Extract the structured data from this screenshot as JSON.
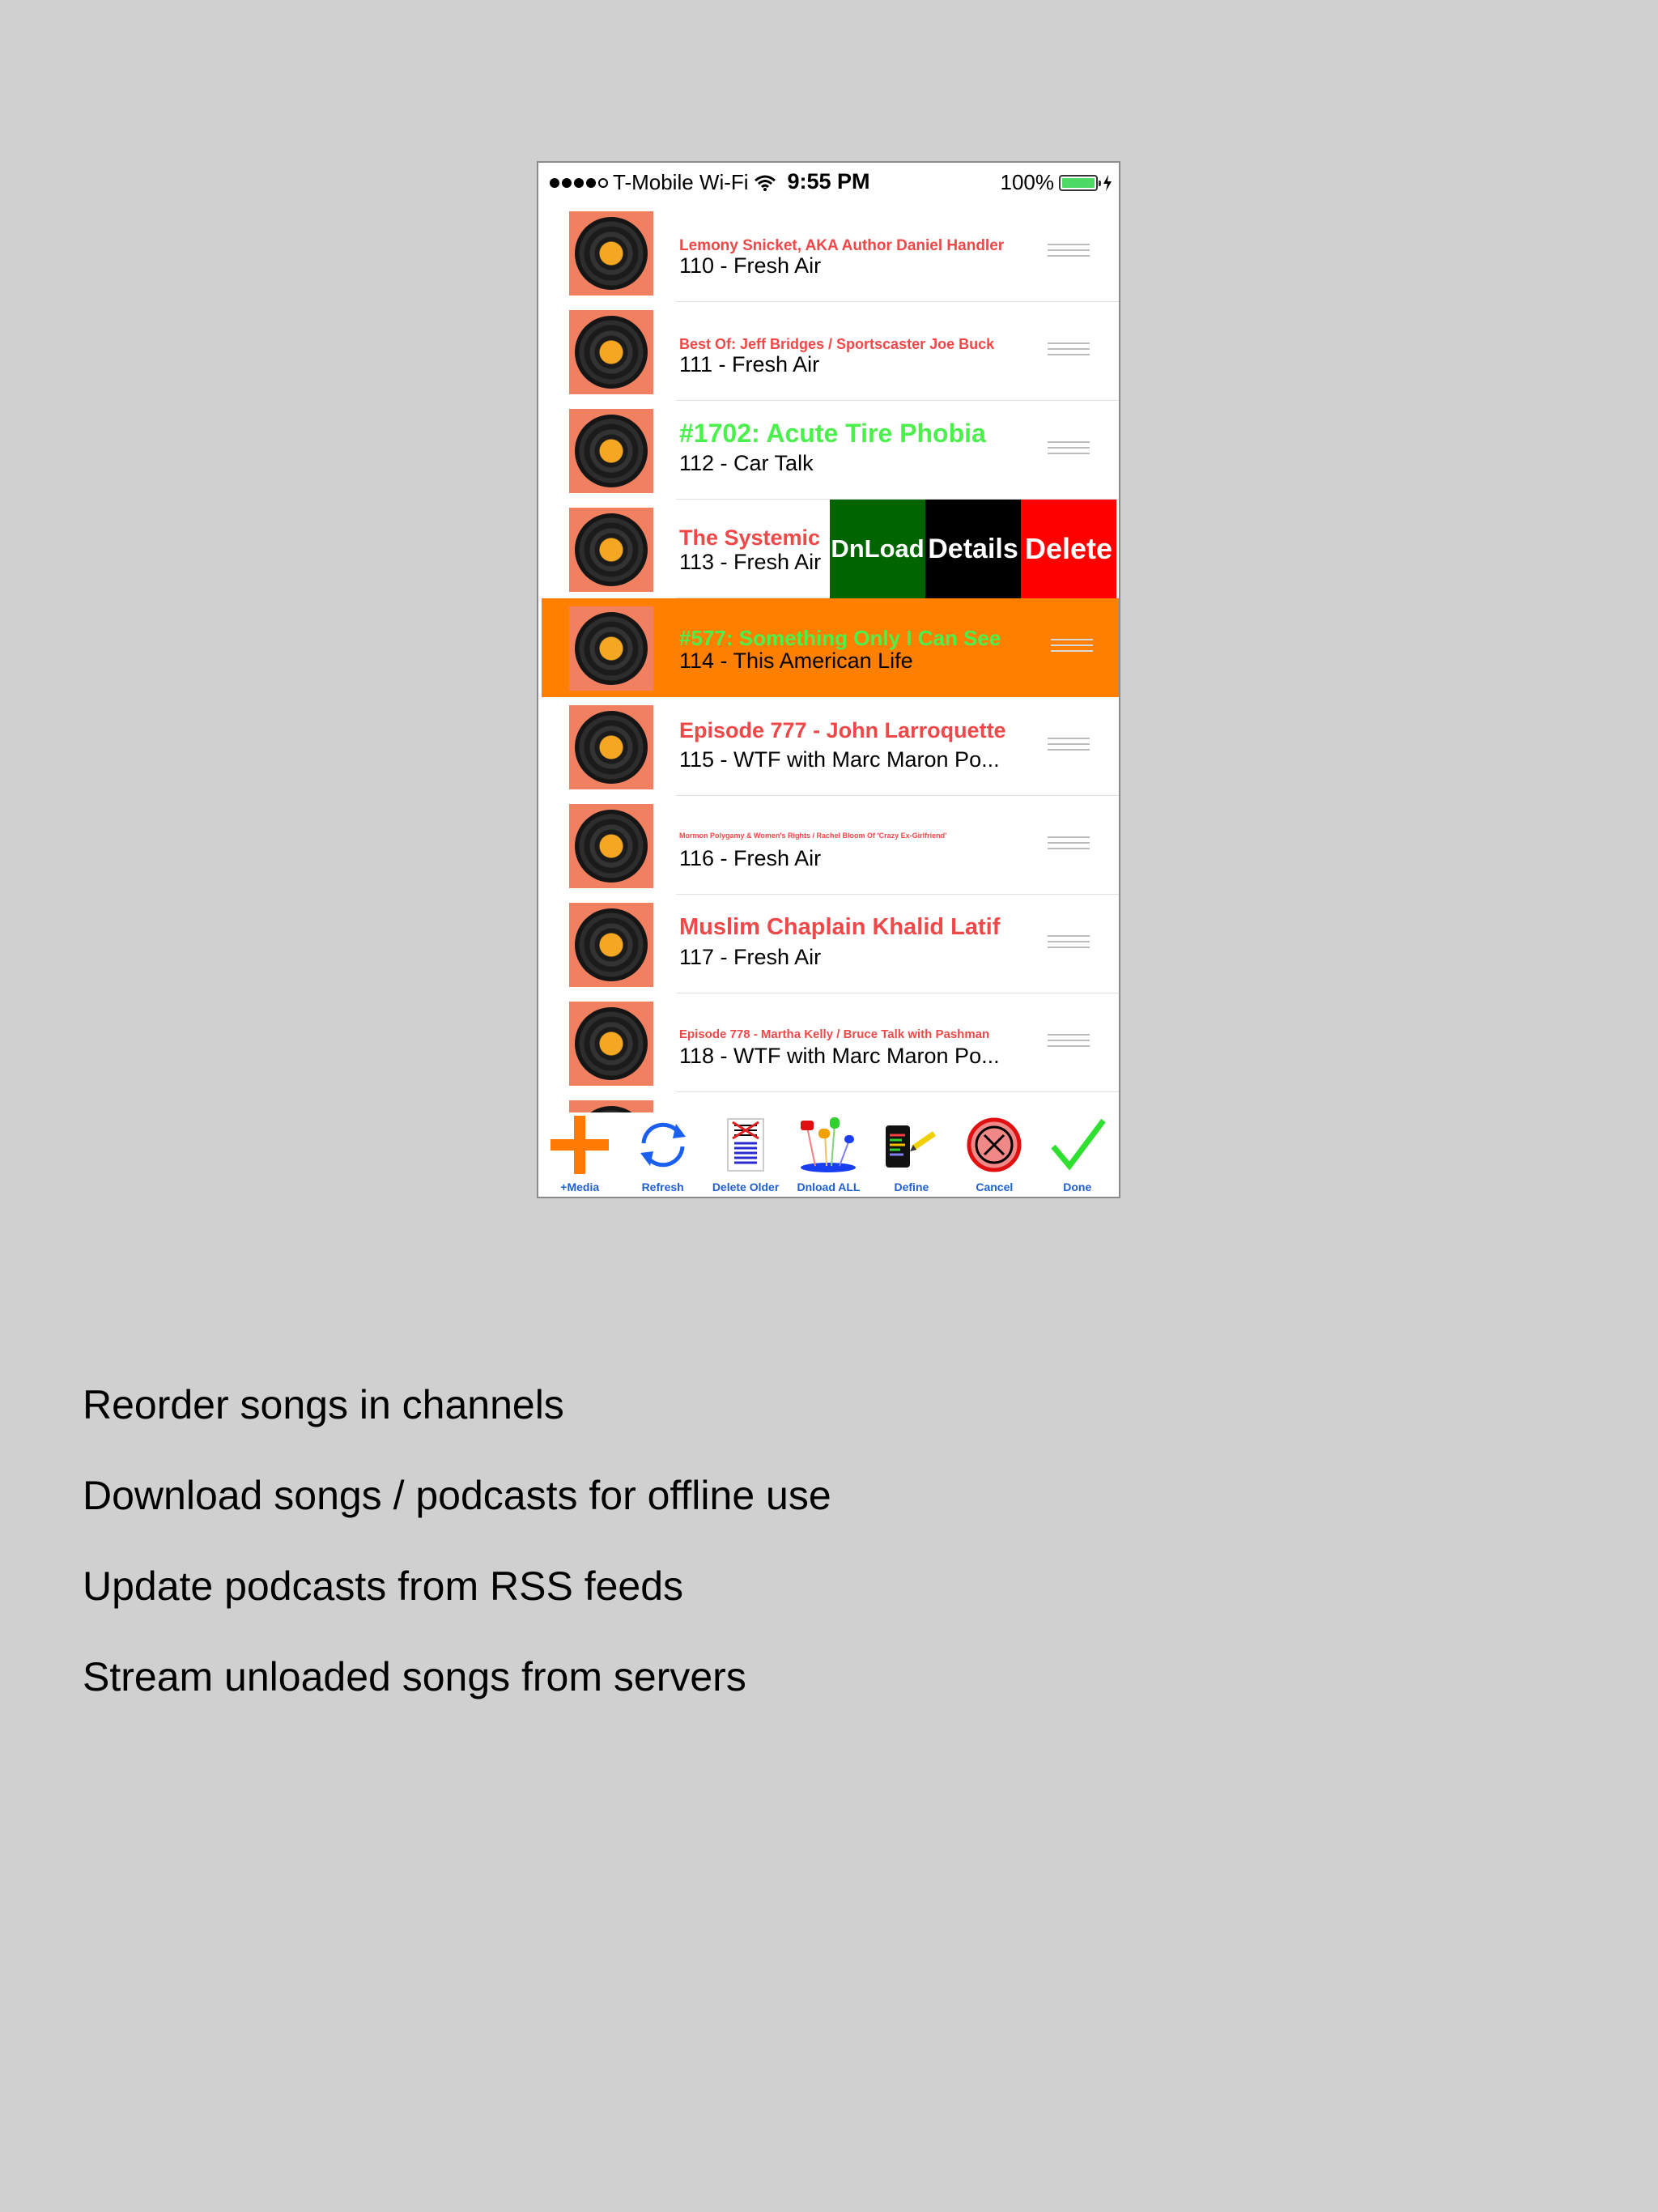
{
  "status": {
    "carrier": "T-Mobile Wi-Fi",
    "time": "9:55 PM",
    "battery": "100%"
  },
  "rows": [
    {
      "title": "Lemony Snicket, AKA Author Daniel Handler",
      "subtitle": "110 - Fresh Air",
      "title_color": "#f04848"
    },
    {
      "title": "Best Of: Jeff Bridges / Sportscaster Joe Buck",
      "subtitle": "111 - Fresh Air",
      "title_color": "#f04848"
    },
    {
      "title": "#1702: Acute Tire Phobia",
      "subtitle": "112 - Car Talk",
      "title_color": "#4cf04c"
    },
    {
      "title": "The Systemic",
      "subtitle": "113 - Fresh Air",
      "title_color": "#f04848"
    },
    {
      "title": "#577: Something Only I Can See",
      "subtitle": "114 - This American Life",
      "title_color": "#4cf04c"
    },
    {
      "title": "Episode 777 - John Larroquette",
      "subtitle": "115 - WTF with Marc Maron Po...",
      "title_color": "#f04848"
    },
    {
      "title": "Mormon Polygamy & Women's Rights / Rachel Bloom Of 'Crazy Ex-Girlfriend'",
      "subtitle": "116 - Fresh Air",
      "title_color": "#f04848"
    },
    {
      "title": "Muslim Chaplain Khalid Latif",
      "subtitle": "117 - Fresh Air",
      "title_color": "#f04848"
    },
    {
      "title": "Episode 778 - Martha Kelly / Bruce Talk with Pashman",
      "subtitle": "118 - WTF with Marc Maron Po...",
      "title_color": "#f04848"
    }
  ],
  "swipe_actions": {
    "download": "DnLoad",
    "details": "Details",
    "delete": "Delete"
  },
  "toolbar": [
    {
      "label": "+Media",
      "icon": "plus-icon"
    },
    {
      "label": "Refresh",
      "icon": "refresh-icon"
    },
    {
      "label": "Delete Older",
      "icon": "delete-older-icon"
    },
    {
      "label": "Dnload ALL",
      "icon": "download-all-icon"
    },
    {
      "label": "Define",
      "icon": "define-icon"
    },
    {
      "label": "Cancel",
      "icon": "cancel-icon"
    },
    {
      "label": "Done",
      "icon": "checkmark-icon"
    }
  ],
  "captions": [
    "Reorder songs in channels",
    "Download songs / podcasts for offline use",
    "Update podcasts from RSS feeds",
    "Stream unloaded songs from servers"
  ],
  "colors": {
    "selected_row": "#ff7f00",
    "download_btn": "#006400",
    "delete_btn": "#ff0000",
    "toolbar_label": "#2060d0"
  }
}
